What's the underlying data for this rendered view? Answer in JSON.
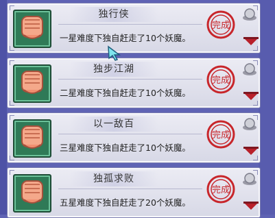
{
  "achievements": [
    {
      "title": "独行侠",
      "description": "一星难度下独自赶走了10个妖魔。",
      "stamp_text": "完成"
    },
    {
      "title": "独步江湖",
      "description": "二星难度下独自赶走了10个妖魔。",
      "stamp_text": "完成"
    },
    {
      "title": "以一敌百",
      "description": "三星难度下独自赶走了10个妖魔。",
      "stamp_text": "完成"
    },
    {
      "title": "独孤求败",
      "description": "五星难度下独自赶走了20个妖魔。",
      "stamp_text": "完成"
    }
  ],
  "colors": {
    "stamp": "#c8262b",
    "arrow": "#b8202a",
    "icon_bg": "#2f7a57"
  }
}
